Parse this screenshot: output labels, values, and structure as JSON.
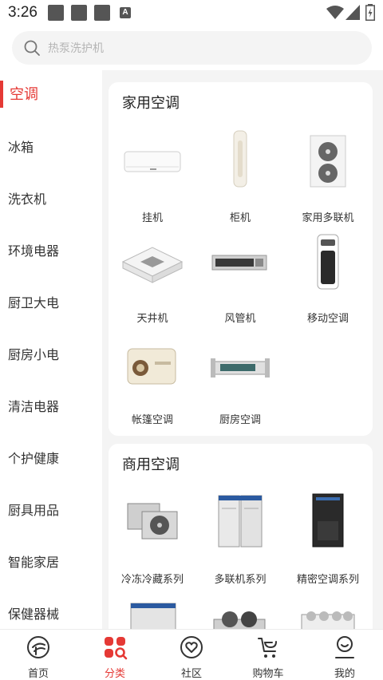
{
  "status_bar": {
    "time": "3:26",
    "a_badge": "A"
  },
  "search": {
    "placeholder": "热泵洗护机"
  },
  "sidebar": {
    "active_color": "#e53935",
    "items": [
      {
        "label": "空调",
        "active": true
      },
      {
        "label": "冰箱"
      },
      {
        "label": "洗衣机"
      },
      {
        "label": "环境电器"
      },
      {
        "label": "厨卫大电"
      },
      {
        "label": "厨房小电"
      },
      {
        "label": "清洁电器"
      },
      {
        "label": "个护健康"
      },
      {
        "label": "厨具用品"
      },
      {
        "label": "智能家居"
      },
      {
        "label": "保健器械"
      }
    ]
  },
  "sections": [
    {
      "title": "家用空调",
      "products": [
        {
          "label": "挂机",
          "icon": "wall-ac-icon"
        },
        {
          "label": "柜机",
          "icon": "tower-ac-icon"
        },
        {
          "label": "家用多联机",
          "icon": "outdoor-unit-icon"
        },
        {
          "label": "天井机",
          "icon": "cassette-ac-icon"
        },
        {
          "label": "风管机",
          "icon": "duct-ac-icon"
        },
        {
          "label": "移动空调",
          "icon": "portable-ac-icon"
        },
        {
          "label": "帐篷空调",
          "icon": "tent-ac-icon"
        },
        {
          "label": "厨房空调",
          "icon": "kitchen-ac-icon"
        }
      ]
    },
    {
      "title": "商用空调",
      "products": [
        {
          "label": "冷冻冷藏系列",
          "icon": "condensing-unit-icon"
        },
        {
          "label": "多联机系列",
          "icon": "vrf-unit-icon"
        },
        {
          "label": "精密空调系列",
          "icon": "precision-ac-icon"
        },
        {
          "label": "",
          "icon": "commercial-unit-icon"
        },
        {
          "label": "",
          "icon": "chiller-icon"
        },
        {
          "label": "",
          "icon": "modular-chiller-icon"
        }
      ]
    }
  ],
  "bottom_nav": {
    "items": [
      {
        "label": "首页",
        "icon": "home-icon"
      },
      {
        "label": "分类",
        "icon": "category-icon",
        "active": true
      },
      {
        "label": "社区",
        "icon": "community-icon"
      },
      {
        "label": "购物车",
        "icon": "cart-icon"
      },
      {
        "label": "我的",
        "icon": "profile-icon"
      }
    ]
  }
}
